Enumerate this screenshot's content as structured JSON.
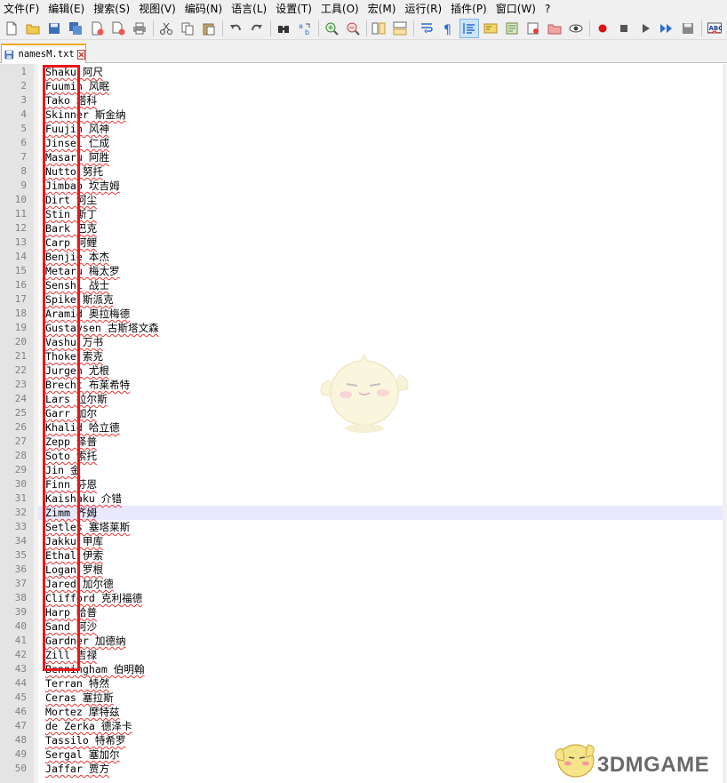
{
  "menu": [
    "文件(F)",
    "编辑(E)",
    "搜索(S)",
    "视图(V)",
    "编码(N)",
    "语言(L)",
    "设置(T)",
    "工具(O)",
    "宏(M)",
    "运行(R)",
    "插件(P)",
    "窗口(W)",
    "?"
  ],
  "toolbar": {
    "icons": [
      "new-file-icon",
      "open-file-icon",
      "save-icon",
      "save-all-icon",
      "close-icon",
      "close-all-icon",
      "print-icon",
      "cut-icon",
      "copy-icon",
      "paste-icon",
      "undo-icon",
      "redo-icon",
      "find-icon",
      "replace-icon",
      "zoom-in-icon",
      "zoom-out-icon",
      "sync-vertical-icon",
      "sync-horizontal-icon",
      "word-wrap-icon",
      "show-all-chars-icon",
      "indent-guide-icon",
      "doc-map-icon",
      "function-list-icon",
      "folder-workspace-icon",
      "doc-switcher-icon",
      "monitor-icon",
      "record-macro-icon",
      "stop-record-icon",
      "play-macro-icon",
      "run-macro-multiple-icon",
      "save-macro-icon",
      "spell-check-icon"
    ]
  },
  "tab": {
    "filename": "namesM.txt"
  },
  "editor": {
    "current_line": 32,
    "lines": [
      "Shaku 阿尺",
      "Fuumin 风眠",
      "Tako 塔科",
      "Skinner 斯金纳",
      "Fuujin 风神",
      "Jinsei 仁成",
      "Masaru 阿胜",
      "Nutto 努托",
      "Jimbab 坎吉姆",
      "Dirt 河尘",
      "Stin 斯丁",
      "Bark 巴克",
      "Carp 阿鲤",
      "Benjie 本杰",
      "Metaru 梅太罗",
      "Senshi 战士",
      "Spike 斯派克",
      "Aramid 奥拉梅德",
      "Gustavsen 古斯塔文森",
      "Vashu 万书",
      "Thoke 索克",
      "Jurgen 尤根",
      "Brecht 布莱希特",
      "Lars 拉尔斯",
      "Garr 加尔",
      "Khalid 哈立德",
      "Zepp 泽普",
      "Soto 索托",
      "Jin 金",
      "Finn 芬恩",
      "Kaishaku 介错",
      "Zimm 齐姆",
      "Setles 塞塔莱斯",
      "Jakku 甲库",
      "Ethal 伊索",
      "Logan 罗根",
      "Jared 加尔德",
      "Clifford 克利福德",
      "Harp 哈普",
      "Sand 阿沙",
      "Gardner 加德纳",
      "Zill 吉禄",
      "Benningham 伯明翰",
      "Terran 特然",
      "Ceras 塞拉斯",
      "Mortez 摩特兹",
      "de Zerka 德泽卡",
      "Tassilo 特希罗",
      "Sergal 塞加尔",
      "Jaffar 贾方"
    ]
  },
  "watermark": {
    "brand": "3DMGAME"
  },
  "colors": {
    "highlight_box": "#e8161b",
    "current_line": "#e8e8ff",
    "tab_accent": "#f5a623",
    "gutter": "#e4e4e4"
  }
}
